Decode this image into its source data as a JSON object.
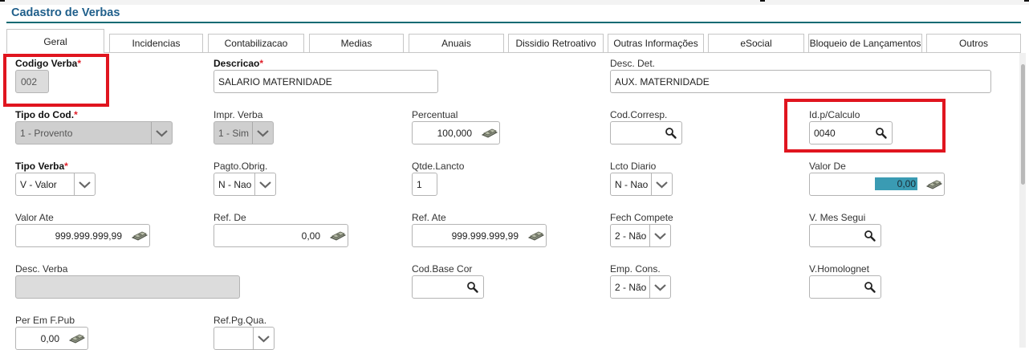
{
  "title": "Cadastro de Verbas",
  "tabs": [
    "Geral",
    "Incidencias",
    "Contabilizacao",
    "Medias",
    "Anuais",
    "Dissidio Retroativo",
    "Outras Informações",
    "eSocial",
    "Bloqueio de Lançamentos",
    "Outros"
  ],
  "fields": {
    "codigo_verba": {
      "label": "Codigo Verba",
      "value": "002"
    },
    "descricao": {
      "label": "Descricao",
      "value": "SALARIO MATERNIDADE"
    },
    "desc_det": {
      "label": "Desc. Det.",
      "value": "AUX. MATERNIDADE"
    },
    "tipo_cod": {
      "label": "Tipo do Cod.",
      "value": "1 - Provento"
    },
    "impr_verba": {
      "label": "Impr. Verba",
      "value": "1 - Sim"
    },
    "percentual": {
      "label": "Percentual",
      "value": "100,000"
    },
    "cod_corresp": {
      "label": "Cod.Corresp.",
      "value": ""
    },
    "id_calculo": {
      "label": "Id.p/Calculo",
      "value": "0040"
    },
    "tipo_verba": {
      "label": "Tipo Verba",
      "value": "V - Valor"
    },
    "pagto_obrig": {
      "label": "Pagto.Obrig.",
      "value": "N - Nao"
    },
    "qtde_lancto": {
      "label": "Qtde.Lancto",
      "value": "1"
    },
    "lcto_diario": {
      "label": "Lcto Diario",
      "value": "N - Nao"
    },
    "valor_de": {
      "label": "Valor De",
      "value": "0,00"
    },
    "valor_ate": {
      "label": "Valor Ate",
      "value": "999.999.999,99"
    },
    "ref_de": {
      "label": "Ref. De",
      "value": "0,00"
    },
    "ref_ate": {
      "label": "Ref. Ate",
      "value": "999.999.999,99"
    },
    "fech_compete": {
      "label": "Fech Compete",
      "value": "2 - Não"
    },
    "v_mes_segui": {
      "label": "V. Mes Segui",
      "value": ""
    },
    "desc_verba": {
      "label": "Desc. Verba",
      "value": ""
    },
    "cod_base_cor": {
      "label": "Cod.Base Cor",
      "value": ""
    },
    "emp_cons": {
      "label": "Emp. Cons.",
      "value": "2 - Não"
    },
    "v_homolognet": {
      "label": "V.Homolognet",
      "value": ""
    },
    "per_em_f_pub": {
      "label": "Per Em F.Pub",
      "value": "0,00"
    },
    "ref_pg_qua": {
      "label": "Ref.Pg.Qua.",
      "value": ""
    }
  },
  "required_mark": "*",
  "icons": {
    "lookup": "magnifier-icon",
    "amount": "money-icon",
    "dropdown": "chevron-down-icon"
  },
  "colors": {
    "title": "#1f5f8b",
    "title_line": "#0f6a73",
    "required": "#e0202a",
    "highlight_box": "#e0151f",
    "selection": "#3a9bb3"
  }
}
